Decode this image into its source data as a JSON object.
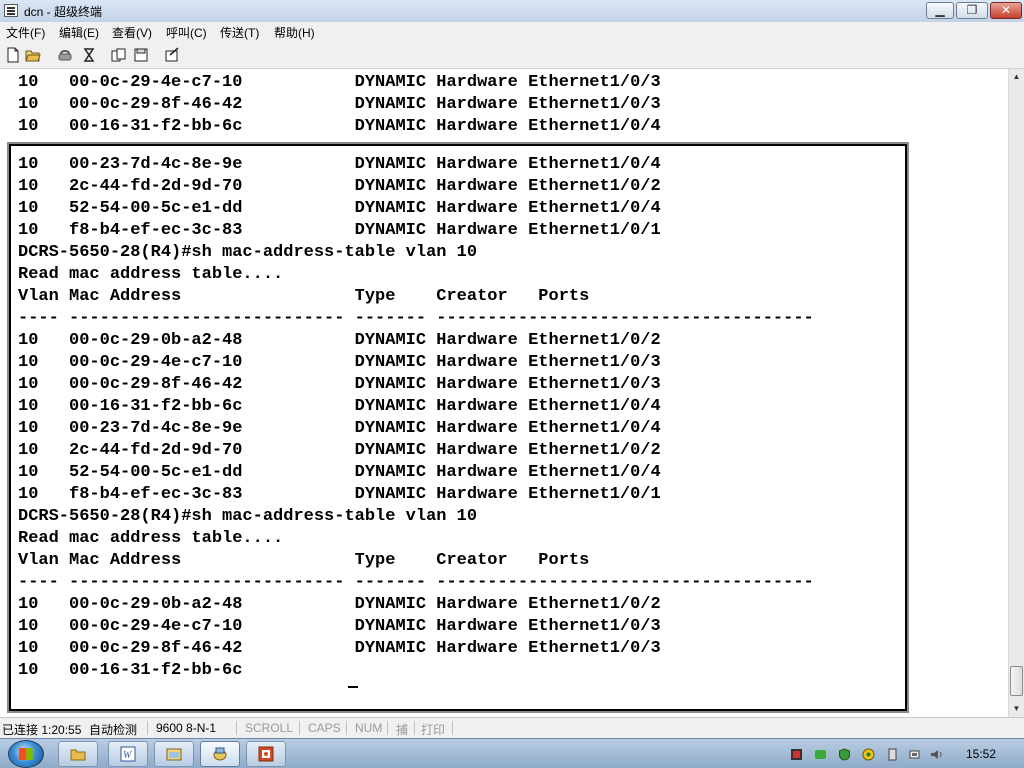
{
  "window": {
    "title": "dcn - 超级终端",
    "min_glyph": "▁",
    "max_glyph": "❐",
    "close_glyph": "✕"
  },
  "menu": [
    "文件(F)",
    "编辑(E)",
    "查看(V)",
    "呼叫(C)",
    "传送(T)",
    "帮助(H)"
  ],
  "toolbar_icons": [
    "new-icon",
    "open-icon",
    "disconnect-icon",
    "call-icon",
    "send-icon",
    "receive-icon",
    "properties-icon"
  ],
  "terminal": {
    "top_lines": "10   00-0c-29-4e-c7-10           DYNAMIC Hardware Ethernet1/0/3\n10   00-0c-29-8f-46-42           DYNAMIC Hardware Ethernet1/0/3\n10   00-16-31-f2-bb-6c           DYNAMIC Hardware Ethernet1/0/4",
    "inner_lines": "10   00-23-7d-4c-8e-9e           DYNAMIC Hardware Ethernet1/0/4\n10   2c-44-fd-2d-9d-70           DYNAMIC Hardware Ethernet1/0/2\n10   52-54-00-5c-e1-dd           DYNAMIC Hardware Ethernet1/0/4\n10   f8-b4-ef-ec-3c-83           DYNAMIC Hardware Ethernet1/0/1\nDCRS-5650-28(R4)#sh mac-address-table vlan 10\nRead mac address table....\nVlan Mac Address                 Type    Creator   Ports\n---- --------------------------- ------- -------------------------------------\n10   00-0c-29-0b-a2-48           DYNAMIC Hardware Ethernet1/0/2\n10   00-0c-29-4e-c7-10           DYNAMIC Hardware Ethernet1/0/3\n10   00-0c-29-8f-46-42           DYNAMIC Hardware Ethernet1/0/3\n10   00-16-31-f2-bb-6c           DYNAMIC Hardware Ethernet1/0/4\n10   00-23-7d-4c-8e-9e           DYNAMIC Hardware Ethernet1/0/4\n10   2c-44-fd-2d-9d-70           DYNAMIC Hardware Ethernet1/0/2\n10   52-54-00-5c-e1-dd           DYNAMIC Hardware Ethernet1/0/4\n10   f8-b4-ef-ec-3c-83           DYNAMIC Hardware Ethernet1/0/1\nDCRS-5650-28(R4)#sh mac-address-table vlan 10\nRead mac address table....\nVlan Mac Address                 Type    Creator   Ports\n---- --------------------------- ------- -------------------------------------\n10   00-0c-29-0b-a2-48           DYNAMIC Hardware Ethernet1/0/2\n10   00-0c-29-4e-c7-10           DYNAMIC Hardware Ethernet1/0/3\n10   00-0c-29-8f-46-42           DYNAMIC Hardware Ethernet1/0/3\n10   00-16-31-f2-bb-6c"
  },
  "statusbar": {
    "connection": "已连接 1:20:55",
    "detect": "自动检测",
    "port_settings": "9600 8-N-1",
    "scroll": "SCROLL",
    "caps": "CAPS",
    "num": "NUM",
    "capture": "捕",
    "print": "打印"
  },
  "taskbar": {
    "start_icon": "windows-start-icon",
    "tasks": [
      "folder-icon",
      "word-icon",
      "explorer-icon",
      "hyperterminal-icon",
      "powerpoint-icon"
    ],
    "clock": "15:52"
  },
  "colors": {
    "terminal_text": "#000000",
    "title_bar": "#c3d3e8",
    "close_button": "#c5402c"
  }
}
